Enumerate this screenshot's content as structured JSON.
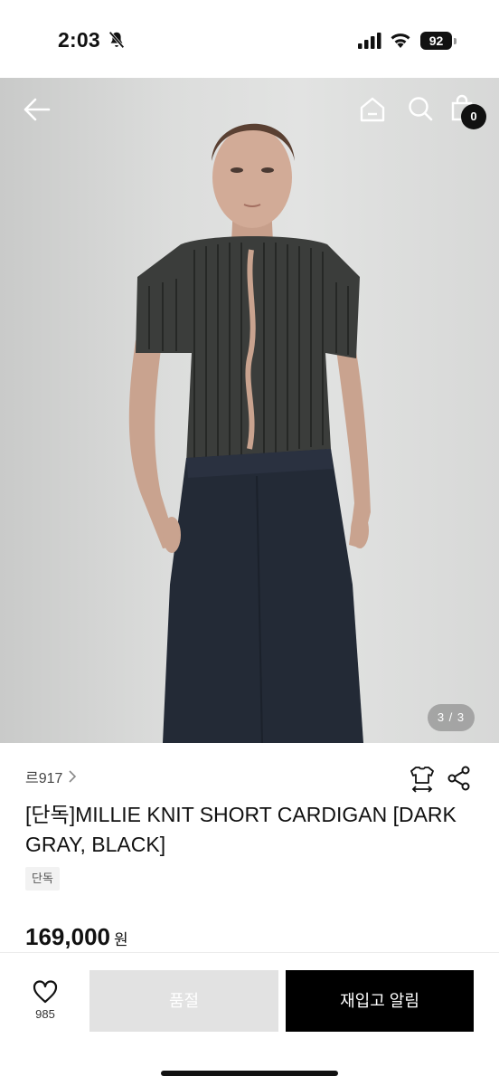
{
  "status_bar": {
    "time": "2:03",
    "battery": "92"
  },
  "top_nav": {
    "cart_count": "0"
  },
  "gallery": {
    "page_indicator": "3 / 3"
  },
  "product": {
    "brand": "르917",
    "title": "[단독]MILLIE KNIT SHORT CARDIGAN [DARK GRAY, BLACK]",
    "tag": "단독",
    "price": "169,000",
    "price_unit": "원"
  },
  "actions": {
    "like_count": "985",
    "soldout_label": "품절",
    "restock_label": "재입고 알림"
  },
  "icons": [
    "bell-off-icon",
    "signal-icon",
    "wifi-icon",
    "battery-icon",
    "back-arrow-icon",
    "home-icon",
    "search-icon",
    "shopping-bag-icon",
    "chevron-right-icon",
    "size-guide-icon",
    "share-icon",
    "heart-icon"
  ],
  "colors": {
    "accent": "#000000",
    "soldout_bg": "#e2e2e2",
    "page_indicator_bg": "#7a7a7a"
  }
}
